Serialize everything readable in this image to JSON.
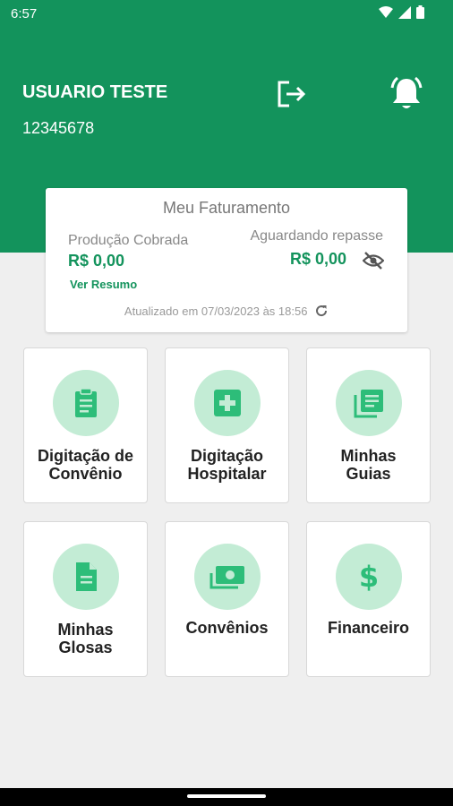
{
  "status": {
    "time": "6:57"
  },
  "user": {
    "name": "USUARIO TESTE",
    "id": "12345678"
  },
  "colors": {
    "brand": "#13935c",
    "icon_bg": "#c3ecd5",
    "icon_fg": "#2dbd79"
  },
  "card": {
    "title": "Meu Faturamento",
    "producao_label": "Produção Cobrada",
    "producao_value": "R$ 0,00",
    "ver_resumo": "Ver Resumo",
    "aguardando_label": "Aguardando repasse",
    "aguardando_value": "R$ 0,00",
    "updated": "Atualizado em 07/03/2023 às 18:56"
  },
  "tiles": [
    {
      "label": "Digitação de\nConvênio",
      "icon": "clipboard-icon"
    },
    {
      "label": "Digitação\nHospitalar",
      "icon": "medical-cross-icon"
    },
    {
      "label": "Minhas\nGuias",
      "icon": "documents-stack-icon"
    },
    {
      "label": "Minhas\nGlosas",
      "icon": "document-icon"
    },
    {
      "label": "Convênios",
      "icon": "money-stack-icon"
    },
    {
      "label": "Financeiro",
      "icon": "dollar-icon"
    }
  ]
}
